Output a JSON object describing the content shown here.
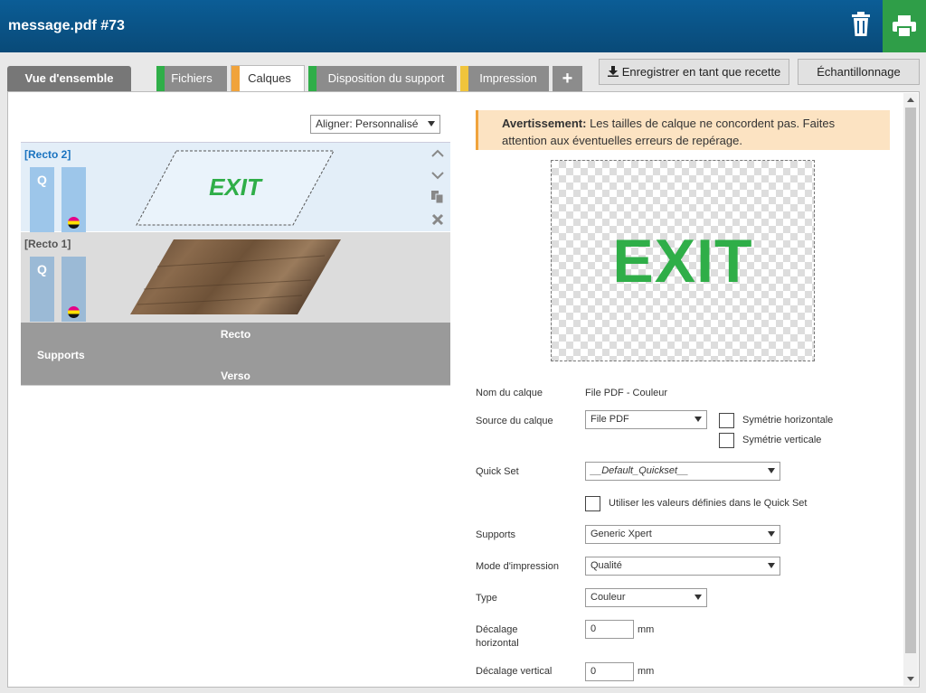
{
  "header": {
    "title": "message.pdf #73"
  },
  "tabs": [
    {
      "label": "Vue d'ensemble"
    },
    {
      "label": "Fichiers",
      "strip": "#2fae48"
    },
    {
      "label": "Calques",
      "strip": "#f0a33c"
    },
    {
      "label": "Disposition du support",
      "strip": "#2fae48"
    },
    {
      "label": "Impression",
      "strip": "#f0c43c"
    }
  ],
  "toolbar": {
    "save_recipe": "Enregistrer en tant que recette",
    "sampling": "Échantillonnage"
  },
  "align": {
    "value": "Aligner: Personnalisé"
  },
  "layers": [
    {
      "name": "[Recto 2]",
      "q": "Q",
      "image_text": "EXIT"
    },
    {
      "name": "[Recto 1]",
      "q": "Q"
    }
  ],
  "media": {
    "recto": "Recto",
    "supports": "Supports",
    "verso": "Verso"
  },
  "warning": {
    "bold": "Avertissement:",
    "text": " Les tailles de calque ne concordent pas. Faites attention aux éventuelles erreurs de repérage."
  },
  "preview": {
    "text": "EXIT"
  },
  "form": {
    "layer_name_label": "Nom du calque",
    "layer_name_value": "File PDF - Couleur",
    "source_label": "Source du calque",
    "source_value": "File PDF",
    "mirror_h": "Symétrie horizontale",
    "mirror_v": "Symétrie verticale",
    "quickset_label": "Quick Set",
    "quickset_value": "__Default_Quickset__",
    "use_quickset": "Utiliser les valeurs définies dans le Quick Set",
    "supports_label": "Supports",
    "supports_value": "Generic Xpert",
    "print_mode_label": "Mode d'impression",
    "print_mode_value": "Qualité",
    "type_label": "Type",
    "type_value": "Couleur",
    "h_offset_label_1": "Décalage",
    "h_offset_label_2": "horizontal",
    "h_offset_value": "0",
    "h_offset_unit": "mm",
    "v_offset_label": "Décalage vertical",
    "v_offset_value": "0",
    "v_offset_unit": "mm"
  }
}
